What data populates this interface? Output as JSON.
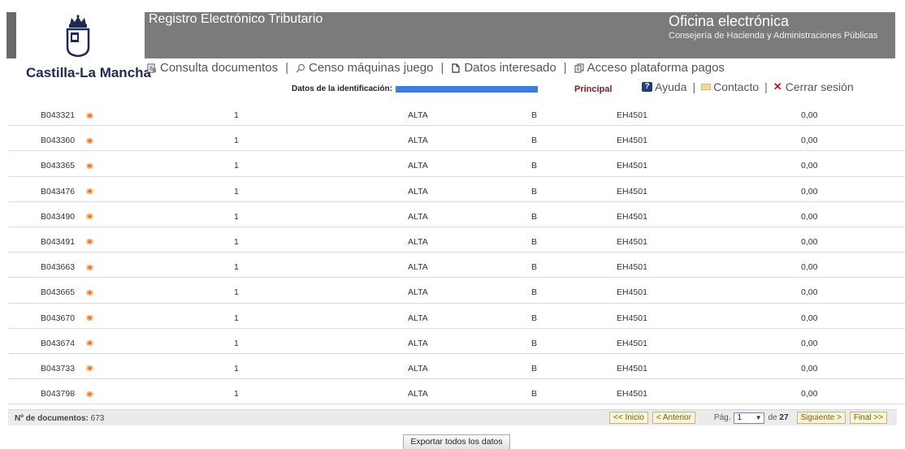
{
  "header": {
    "brand": "Castilla-La Mancha",
    "app_title": "Registro Electrónico Tributario",
    "office_title": "Oficina electrónica",
    "office_subtitle": "Consejería de Hacienda y Administraciones Públicas"
  },
  "nav": {
    "items": [
      {
        "label": "Consulta documentos",
        "icon": "document-icon"
      },
      {
        "label": "Censo máquinas juego",
        "icon": "magnifier-icon"
      },
      {
        "label": "Datos interesado",
        "icon": "file-icon"
      },
      {
        "label": "Acceso plataforma pagos",
        "icon": "pages-icon"
      }
    ]
  },
  "identification": {
    "label": "Datos de la identificación:",
    "principal": "Principal"
  },
  "links": {
    "help": "Ayuda",
    "contact": "Contacto",
    "logout": "Cerrar sesión"
  },
  "table": {
    "rows": [
      {
        "id": "B043321",
        "qty": "1",
        "state": "ALTA",
        "type": "B",
        "code": "EH4501",
        "amount": "0,00"
      },
      {
        "id": "B043360",
        "qty": "1",
        "state": "ALTA",
        "type": "B",
        "code": "EH4501",
        "amount": "0,00"
      },
      {
        "id": "B043365",
        "qty": "1",
        "state": "ALTA",
        "type": "B",
        "code": "EH4501",
        "amount": "0,00"
      },
      {
        "id": "B043476",
        "qty": "1",
        "state": "ALTA",
        "type": "B",
        "code": "EH4501",
        "amount": "0,00"
      },
      {
        "id": "B043490",
        "qty": "1",
        "state": "ALTA",
        "type": "B",
        "code": "EH4501",
        "amount": "0,00"
      },
      {
        "id": "B043491",
        "qty": "1",
        "state": "ALTA",
        "type": "B",
        "code": "EH4501",
        "amount": "0,00"
      },
      {
        "id": "B043663",
        "qty": "1",
        "state": "ALTA",
        "type": "B",
        "code": "EH4501",
        "amount": "0,00"
      },
      {
        "id": "B043665",
        "qty": "1",
        "state": "ALTA",
        "type": "B",
        "code": "EH4501",
        "amount": "0,00"
      },
      {
        "id": "B043670",
        "qty": "1",
        "state": "ALTA",
        "type": "B",
        "code": "EH4501",
        "amount": "0,00"
      },
      {
        "id": "B043674",
        "qty": "1",
        "state": "ALTA",
        "type": "B",
        "code": "EH4501",
        "amount": "0,00"
      },
      {
        "id": "B043733",
        "qty": "1",
        "state": "ALTA",
        "type": "B",
        "code": "EH4501",
        "amount": "0,00"
      },
      {
        "id": "B043798",
        "qty": "1",
        "state": "ALTA",
        "type": "B",
        "code": "EH4501",
        "amount": "0,00"
      }
    ]
  },
  "footer": {
    "count_label": "Nº de documentos:",
    "count_value": "673",
    "first": "<< Inicio",
    "prev": "< Anterior",
    "page_label": "Pág.",
    "page_current": "1",
    "of_label": "de",
    "page_total": "27",
    "next": "Siguiente >",
    "last": "Final >>"
  },
  "export_label": "Exportar todos los datos",
  "colors": {
    "band": "#7b7b7b",
    "brand": "#1d2b54",
    "principal": "#7a1f1f",
    "logout_x": "#c0171b",
    "eye": "#f6b27a"
  }
}
